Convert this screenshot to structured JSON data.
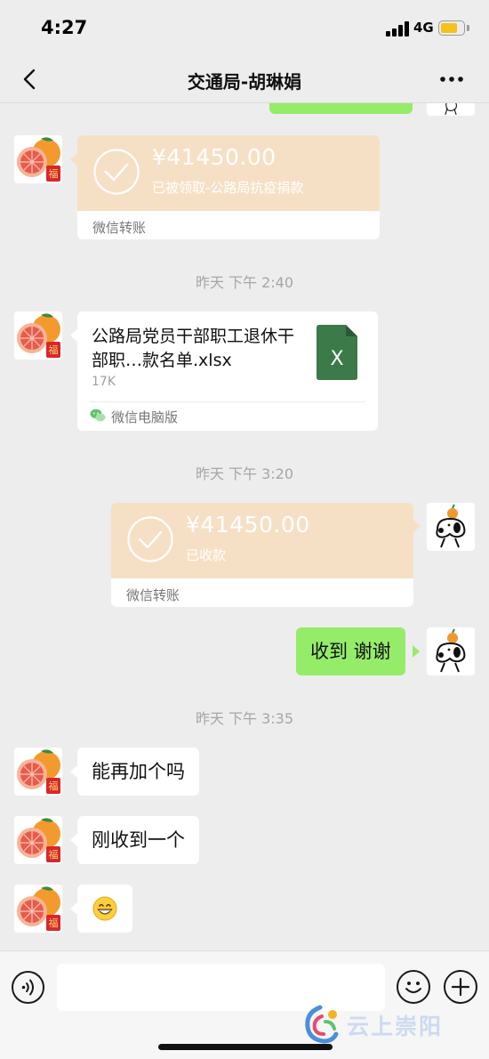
{
  "status_bar": {
    "time": "4:27",
    "network": "4G"
  },
  "header": {
    "title": "交通局-胡琳娟"
  },
  "messages": {
    "transfer_1": {
      "amount": "¥41450.00",
      "status": "已被领取-公路局抗疫捐款",
      "label": "微信转账"
    },
    "time_1": "昨天 下午 2:40",
    "file": {
      "name": "公路局党员干部职工退休干部职…款名单.xlsx",
      "size": "17K",
      "source": "微信电脑版",
      "icon_letter": "X"
    },
    "time_2": "昨天 下午 3:20",
    "transfer_2": {
      "amount": "¥41450.00",
      "status": "已收款",
      "label": "微信转账"
    },
    "reply_1": "收到 谢谢",
    "time_3": "昨天 下午 3:35",
    "msg_1": "能再加个吗",
    "msg_2": "刚收到一个",
    "msg_3": "😁"
  },
  "input": {
    "placeholder": ""
  },
  "watermark": {
    "text": "云上崇阳"
  },
  "colors": {
    "background": "#ededed",
    "sent_bubble": "#95ec69",
    "transfer_card": "#f6e0c5",
    "excel_green": "#3c7a4a"
  }
}
